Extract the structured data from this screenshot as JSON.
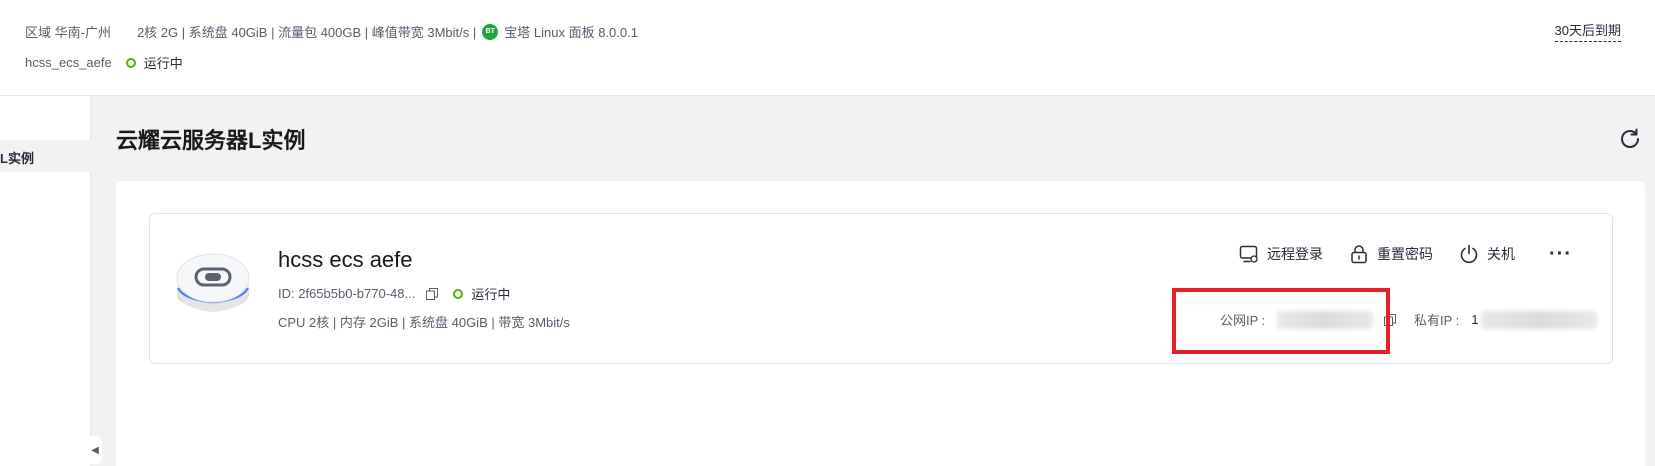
{
  "header": {
    "region": "区域 华南-广州",
    "specs": "2核  2G | 系统盘 40GiB | 流量包 400GB | 峰值带宽 3Mbit/s |",
    "image_badge": "BT",
    "image": "宝塔 Linux 面板 8.0.0.1",
    "instance_name": "hcss_ecs_aefe",
    "status": "运行中",
    "expire": "30天后到期"
  },
  "sidebar": {
    "items": [
      {
        "label": "L实例"
      }
    ]
  },
  "page": {
    "title": "云耀云服务器L实例"
  },
  "instance": {
    "name": "hcss  ecs  aefe",
    "id": "ID: 2f65b5b0-b770-48...",
    "status": "运行中",
    "spec": "CPU 2核 | 内存 2GiB | 系统盘 40GiB | 带宽 3Mbit/s",
    "actions": {
      "remote_login": "远程登录",
      "reset_password": "重置密码",
      "shutdown": "关机",
      "more": "···"
    },
    "public_ip_label": "公网IP :",
    "private_ip_label": "私有IP :",
    "private_ip_prefix": "1"
  },
  "colors": {
    "status_green": "#50b400",
    "highlight_red": "#e5202b",
    "bt_badge_green": "#20a53a"
  },
  "icons": {
    "copy": "copy-icon",
    "refresh": "refresh-icon",
    "remote_login": "monitor-icon",
    "reset_password": "lock-icon",
    "shutdown": "power-icon",
    "collapse": "chevron-left-icon"
  }
}
